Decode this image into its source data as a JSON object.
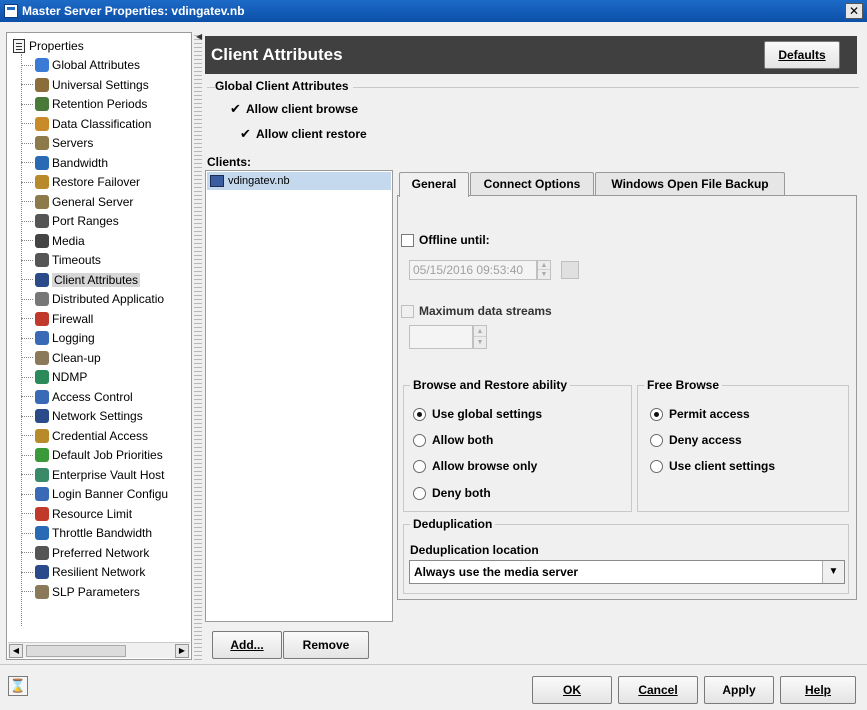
{
  "window": {
    "title": "Master Server Properties: vdingatev.nb",
    "close_label": "✕"
  },
  "tree": {
    "root": "Properties",
    "items": [
      {
        "label": "Global Attributes",
        "icon": "globe-icon",
        "color": "#3a7bd5"
      },
      {
        "label": "Universal Settings",
        "icon": "universal-settings-icon",
        "color": "#8a6d3b"
      },
      {
        "label": "Retention Periods",
        "icon": "retention-icon",
        "color": "#4a7a3a"
      },
      {
        "label": "Data Classification",
        "icon": "data-classification-icon",
        "color": "#c98a2a"
      },
      {
        "label": "Servers",
        "icon": "servers-icon",
        "color": "#8c7a4a"
      },
      {
        "label": "Bandwidth",
        "icon": "bandwidth-icon",
        "color": "#2a6ab5"
      },
      {
        "label": "Restore Failover",
        "icon": "restore-failover-icon",
        "color": "#b78a2a"
      },
      {
        "label": "General Server",
        "icon": "general-server-icon",
        "color": "#8c7a4a"
      },
      {
        "label": "Port Ranges",
        "icon": "port-ranges-icon",
        "color": "#555555"
      },
      {
        "label": "Media",
        "icon": "media-icon",
        "color": "#444444"
      },
      {
        "label": "Timeouts",
        "icon": "timeouts-icon",
        "color": "#555555"
      },
      {
        "label": "Client Attributes",
        "icon": "client-attributes-icon",
        "color": "#2a4a8a"
      },
      {
        "label": "Distributed Applicatio",
        "icon": "distributed-application-icon",
        "color": "#777777"
      },
      {
        "label": "Firewall",
        "icon": "firewall-icon",
        "color": "#c0392b"
      },
      {
        "label": "Logging",
        "icon": "logging-icon",
        "color": "#3a6ab5"
      },
      {
        "label": "Clean-up",
        "icon": "clean-up-icon",
        "color": "#8a7a5a"
      },
      {
        "label": "NDMP",
        "icon": "ndmp-icon",
        "color": "#2a8a5a"
      },
      {
        "label": "Access Control",
        "icon": "access-control-icon",
        "color": "#3a6ab5"
      },
      {
        "label": "Network Settings",
        "icon": "network-settings-icon",
        "color": "#2a4a8a"
      },
      {
        "label": "Credential Access",
        "icon": "credential-access-icon",
        "color": "#b78a2a"
      },
      {
        "label": "Default Job Priorities",
        "icon": "job-priorities-icon",
        "color": "#3a9a3a"
      },
      {
        "label": "Enterprise Vault Host",
        "icon": "enterprise-vault-icon",
        "color": "#3a8a6a"
      },
      {
        "label": "Login Banner Configu",
        "icon": "login-banner-icon",
        "color": "#3a6ab5"
      },
      {
        "label": "Resource Limit",
        "icon": "resource-limit-icon",
        "color": "#c0392b"
      },
      {
        "label": "Throttle Bandwidth",
        "icon": "throttle-bandwidth-icon",
        "color": "#2a6ab5"
      },
      {
        "label": "Preferred Network",
        "icon": "preferred-network-icon",
        "color": "#555555"
      },
      {
        "label": "Resilient Network",
        "icon": "resilient-network-icon",
        "color": "#2a4a8a"
      },
      {
        "label": "SLP Parameters",
        "icon": "slp-parameters-icon",
        "color": "#8a7a5a"
      }
    ],
    "selected": "Client Attributes",
    "scroll_left": "◀",
    "scroll_right": "▶"
  },
  "header": {
    "title": "Client Attributes",
    "defaults_label": "Defaults"
  },
  "global_client_attributes": {
    "legend": "Global Client Attributes",
    "allow_browse": {
      "label": "Allow client browse",
      "checked": true
    },
    "allow_restore": {
      "label": "Allow client restore",
      "checked": true
    }
  },
  "clients": {
    "label": "Clients:",
    "items": [
      "vdingatev.nb"
    ],
    "add_label": "Add...",
    "remove_label": "Remove"
  },
  "tabs": [
    {
      "label": "General",
      "active": true
    },
    {
      "label": "Connect Options",
      "active": false
    },
    {
      "label": "Windows Open File Backup",
      "active": false
    }
  ],
  "general": {
    "offline_until": {
      "label": "Offline until:",
      "checked": false
    },
    "offline_datetime": "05/15/2016 09:53:40",
    "max_streams": {
      "label": "Maximum data streams",
      "checked": false,
      "value": ""
    },
    "browse_restore": {
      "legend": "Browse and Restore ability",
      "options": [
        {
          "label": "Use global settings",
          "selected": true
        },
        {
          "label": "Allow both",
          "selected": false
        },
        {
          "label": "Allow browse only",
          "selected": false
        },
        {
          "label": "Deny both",
          "selected": false
        }
      ]
    },
    "free_browse": {
      "legend": "Free Browse",
      "options": [
        {
          "label": "Permit access",
          "selected": true
        },
        {
          "label": "Deny access",
          "selected": false
        },
        {
          "label": "Use client settings",
          "selected": false
        }
      ]
    },
    "deduplication": {
      "legend": "Deduplication",
      "location_label": "Deduplication location",
      "location_value": "Always use the media server"
    }
  },
  "footer": {
    "hourglass": "⌛",
    "ok_label": "OK",
    "cancel_label": "Cancel",
    "apply_label": "Apply",
    "help_label": "Help"
  }
}
